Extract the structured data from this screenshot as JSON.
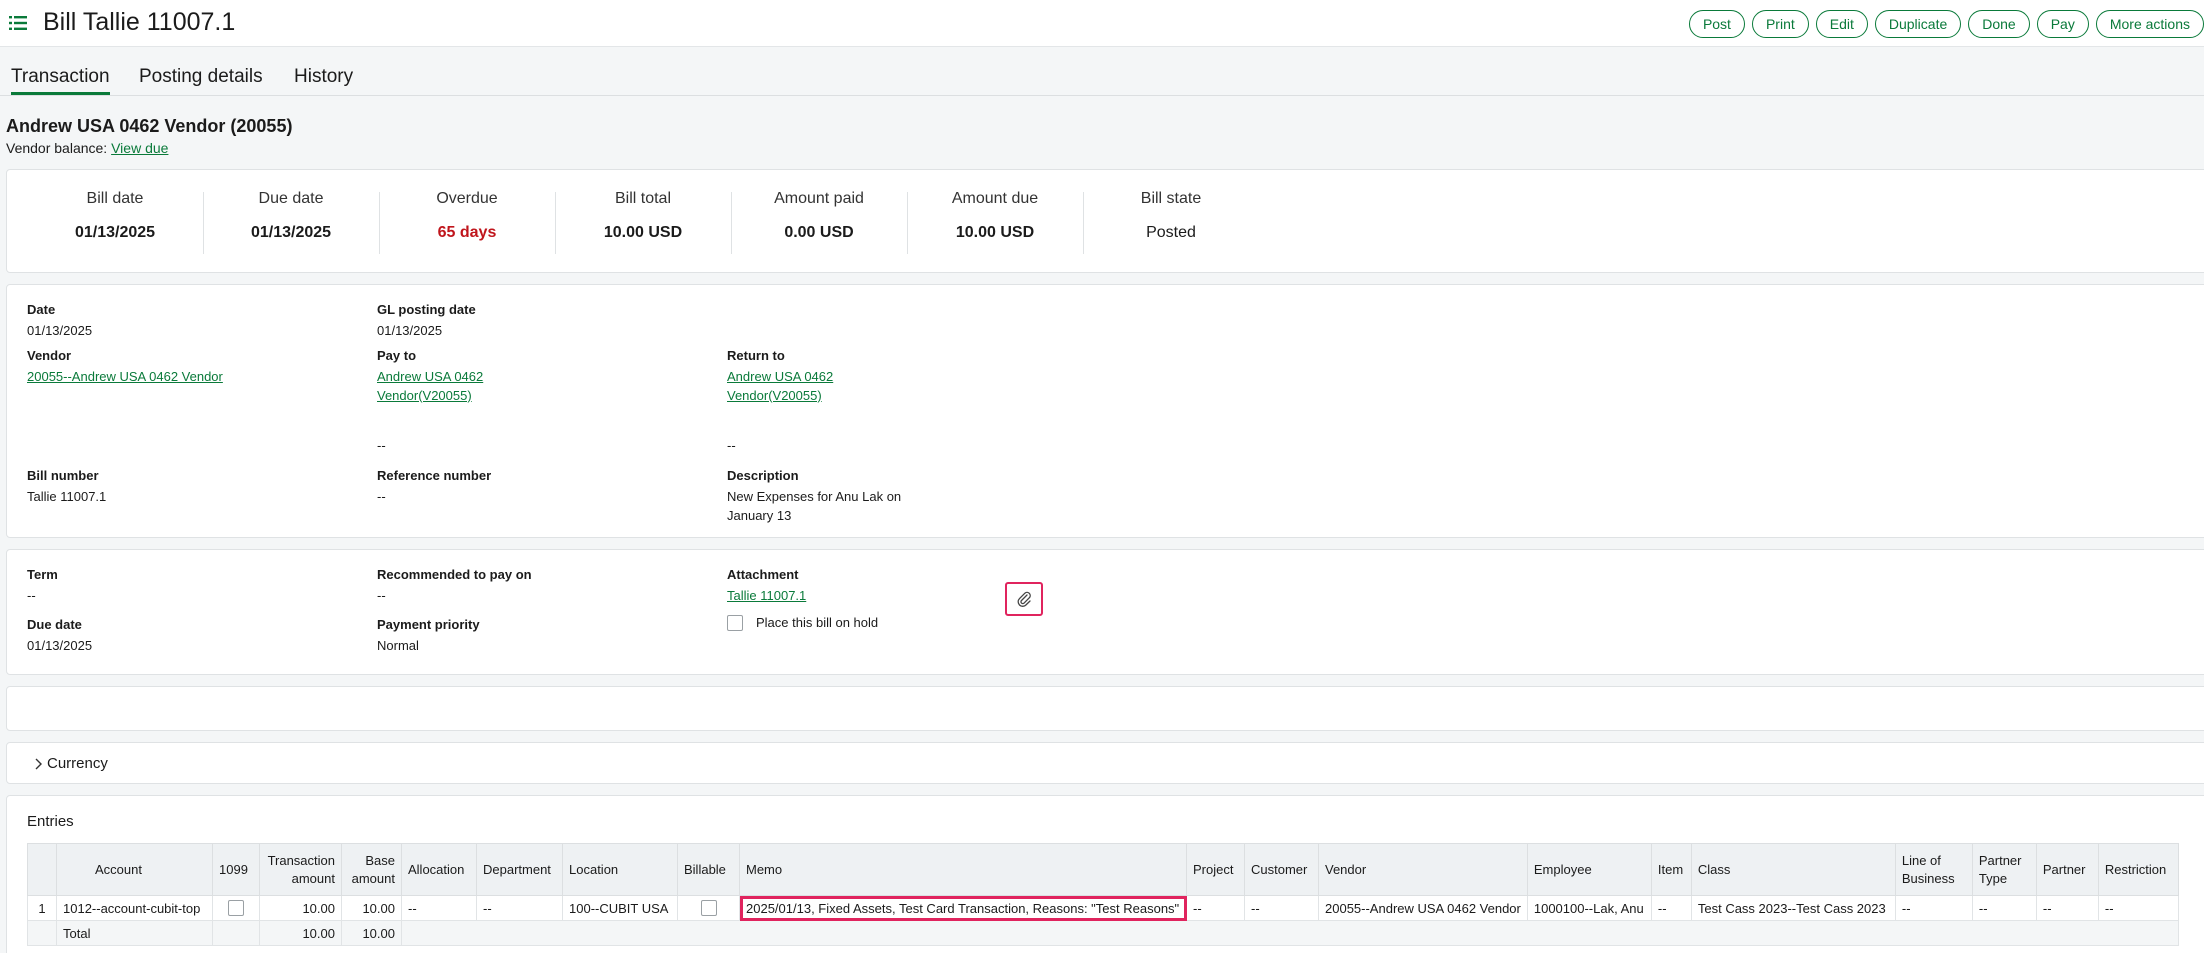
{
  "header": {
    "title": "Bill Tallie 11007.1",
    "actions": [
      "Post",
      "Print",
      "Edit",
      "Duplicate",
      "Done",
      "Pay",
      "More actions"
    ]
  },
  "tabs": [
    {
      "label": "Transaction",
      "active": true
    },
    {
      "label": "Posting details",
      "active": false
    },
    {
      "label": "History",
      "active": false
    }
  ],
  "vendor": {
    "title": "Andrew USA 0462 Vendor (20055)",
    "balance_label": "Vendor balance:",
    "balance_link": "View due"
  },
  "summary": [
    {
      "label": "Bill date",
      "value": "01/13/2025"
    },
    {
      "label": "Due date",
      "value": "01/13/2025"
    },
    {
      "label": "Overdue",
      "value": "65 days"
    },
    {
      "label": "Bill total",
      "value": "10.00 USD"
    },
    {
      "label": "Amount paid",
      "value": "0.00 USD"
    },
    {
      "label": "Amount due",
      "value": "10.00 USD"
    },
    {
      "label": "Bill state",
      "value": "Posted"
    }
  ],
  "details": {
    "date_label": "Date",
    "date": "01/13/2025",
    "gl_label": "GL posting date",
    "gl": "01/13/2025",
    "vendor_label": "Vendor",
    "vendor": "20055--Andrew USA 0462 Vendor",
    "payto_label": "Pay to",
    "payto_line1": "Andrew USA 0462",
    "payto_line2": "Vendor(V20055)",
    "payto_extra": "--",
    "returnto_label": "Return to",
    "returnto_line1": "Andrew USA 0462",
    "returnto_line2": "Vendor(V20055)",
    "returnto_extra": "--",
    "billno_label": "Bill number",
    "billno": "Tallie 11007.1",
    "refno_label": "Reference number",
    "refno": "--",
    "desc_label": "Description",
    "desc_line1": "New Expenses for Anu Lak on",
    "desc_line2": "January 13"
  },
  "terms": {
    "term_label": "Term",
    "term": "--",
    "recommended_label": "Recommended to pay on",
    "recommended": "--",
    "attachment_label": "Attachment",
    "attachment": "Tallie 11007.1",
    "hold_label": "Place this bill on hold",
    "duedate_label": "Due date",
    "duedate": "01/13/2025",
    "priority_label": "Payment priority",
    "priority": "Normal"
  },
  "currency": {
    "label": "Currency"
  },
  "entries": {
    "title": "Entries",
    "headers": [
      "",
      "Account",
      "1099",
      "Transaction amount",
      "Base amount",
      "Allocation",
      "Department",
      "Location",
      "Billable",
      "Memo",
      "Project",
      "Customer",
      "Vendor",
      "Employee",
      "Item",
      "Class",
      "Line of Business",
      "Partner Type",
      "Partner",
      "Restriction"
    ],
    "row": {
      "num": "1",
      "account": "1012--account-cubit-top",
      "transaction_amount": "10.00",
      "base_amount": "10.00",
      "allocation": "--",
      "department": "--",
      "location": "100--CUBIT USA",
      "memo": "2025/01/13, Fixed Assets, Test Card Transaction, Reasons: \"Test Reasons\"",
      "project": "--",
      "customer": "--",
      "vendor": "20055--Andrew USA 0462 Vendor",
      "employee": "1000100--Lak, Anu",
      "item": "--",
      "class": "Test Cass 2023--Test Cass 2023",
      "line_of_business": "--",
      "partner_type": "--",
      "partner": "--",
      "restriction": "--"
    },
    "total": {
      "label": "Total",
      "transaction_amount": "10.00",
      "base_amount": "10.00"
    }
  }
}
